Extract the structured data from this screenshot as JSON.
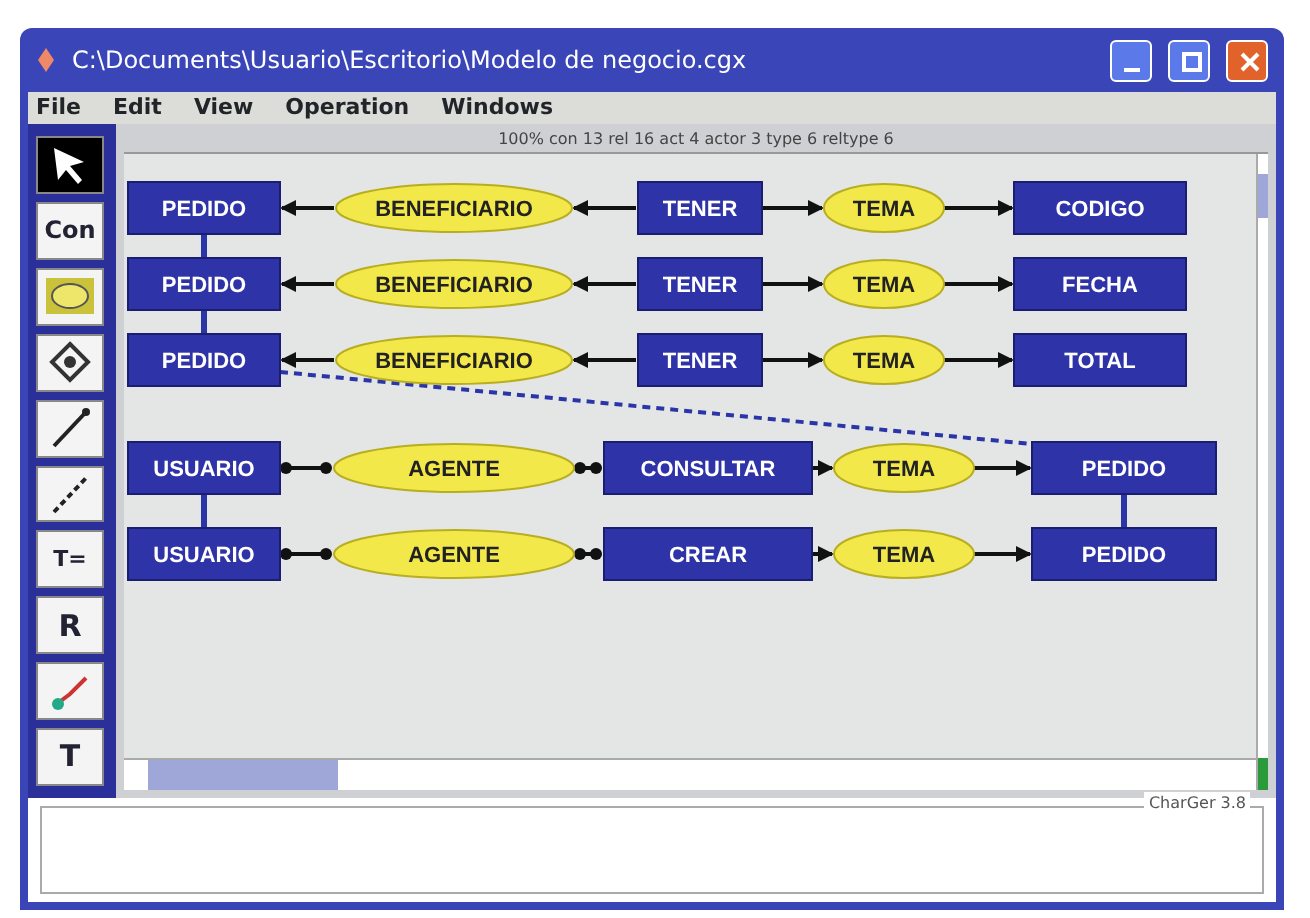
{
  "window": {
    "title": "C:\\Documents\\Usuario\\Escritorio\\Modelo de negocio.cgx"
  },
  "menu": [
    "File",
    "Edit",
    "View",
    "Operation",
    "Windows"
  ],
  "status": "100%   con 13 rel 16 act 4 actor 3 type 6 reltype 6",
  "tools": [
    {
      "kind": "pointer",
      "selected": true
    },
    {
      "kind": "text",
      "label": "Con",
      "selected": false
    },
    {
      "kind": "relation",
      "selected": false
    },
    {
      "kind": "actor",
      "selected": false
    },
    {
      "kind": "arrow",
      "selected": false
    },
    {
      "kind": "coref",
      "selected": false
    },
    {
      "kind": "typelabel",
      "label": "T=",
      "selected": false
    },
    {
      "kind": "letter",
      "label": "R",
      "selected": false
    },
    {
      "kind": "branch",
      "selected": false
    },
    {
      "kind": "letter",
      "label": "T",
      "selected": false
    }
  ],
  "graphs": [
    {
      "kind": "attribute",
      "nodes": [
        {
          "label": "PEDIDO",
          "kind": "concept"
        },
        {
          "label": "BENEFICIARIO",
          "kind": "relation"
        },
        {
          "label": "TENER",
          "kind": "concept"
        },
        {
          "label": "TEMA",
          "kind": "relation"
        },
        {
          "label": "CODIGO",
          "kind": "concept"
        }
      ]
    },
    {
      "kind": "attribute",
      "nodes": [
        {
          "label": "PEDIDO",
          "kind": "concept"
        },
        {
          "label": "BENEFICIARIO",
          "kind": "relation"
        },
        {
          "label": "TENER",
          "kind": "concept"
        },
        {
          "label": "TEMA",
          "kind": "relation"
        },
        {
          "label": "FECHA",
          "kind": "concept"
        }
      ]
    },
    {
      "kind": "attribute",
      "nodes": [
        {
          "label": "PEDIDO",
          "kind": "concept"
        },
        {
          "label": "BENEFICIARIO",
          "kind": "relation"
        },
        {
          "label": "TENER",
          "kind": "concept"
        },
        {
          "label": "TEMA",
          "kind": "relation"
        },
        {
          "label": "TOTAL",
          "kind": "concept"
        }
      ]
    },
    {
      "kind": "action",
      "nodes": [
        {
          "label": "USUARIO",
          "kind": "concept"
        },
        {
          "label": "AGENTE",
          "kind": "relation"
        },
        {
          "label": "CONSULTAR",
          "kind": "concept"
        },
        {
          "label": "TEMA",
          "kind": "relation"
        },
        {
          "label": "PEDIDO",
          "kind": "concept"
        }
      ]
    },
    {
      "kind": "action",
      "nodes": [
        {
          "label": "USUARIO",
          "kind": "concept"
        },
        {
          "label": "AGENTE",
          "kind": "relation"
        },
        {
          "label": "CREAR",
          "kind": "concept"
        },
        {
          "label": "TEMA",
          "kind": "relation"
        },
        {
          "label": "PEDIDO",
          "kind": "concept"
        }
      ]
    }
  ],
  "footer": {
    "label": "CharGer 3.8"
  }
}
